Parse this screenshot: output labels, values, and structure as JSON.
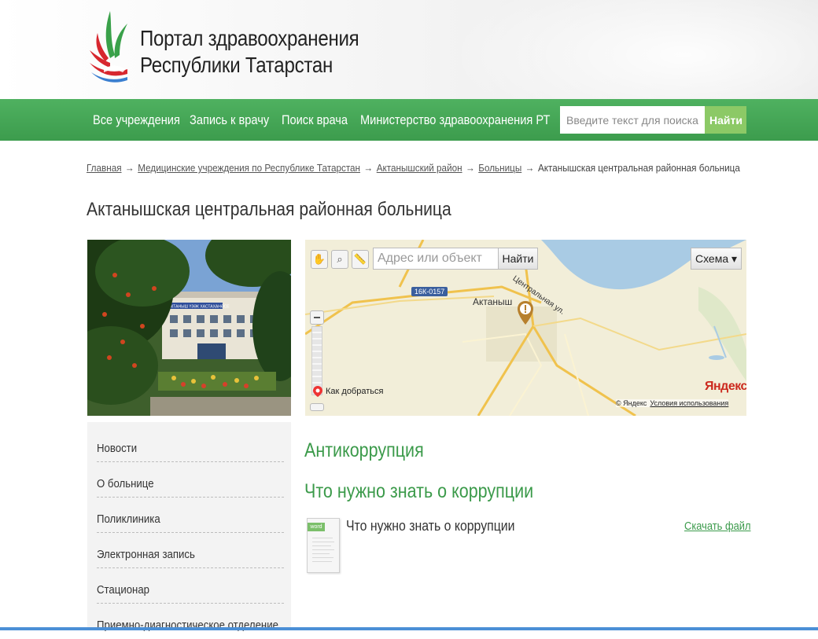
{
  "header": {
    "title_line1": "Портал здравоохранения",
    "title_line2": "Республики Татарстан"
  },
  "nav": {
    "items": [
      "Все учреждения",
      "Запись к врачу",
      "Поиск врача",
      "Министерство здравоохранения РТ"
    ],
    "search_placeholder": "Введите текст для поиска",
    "search_button": "Найти"
  },
  "breadcrumb": {
    "links": [
      "Главная",
      "Медицинские учреждения по Республике Татарстан",
      "Актанышский район",
      "Больницы"
    ],
    "current": "Актанышская центральная районная больница",
    "separator": "→"
  },
  "page_title": "Актанышская центральная районная больница",
  "photo": {
    "sign_text": "АКТАНЫШ ҮЗӘК ХАСТАХАНӘСЕ"
  },
  "map": {
    "search_placeholder": "Адрес или объект",
    "find_button": "Найти",
    "layer_button": "Схема ▾",
    "road_badge": "16К-0157",
    "town_label": "Актаныш",
    "street_label": "Центральная ул.",
    "how_to_get": "Как добраться",
    "copyright": "© Яндекс",
    "terms_link": "Условия использования",
    "brand": "Яндекс"
  },
  "sidebar": {
    "items": [
      "Новости",
      "О больнице",
      "Поликлиника",
      "Электронная запись",
      "Стационар",
      "Приемно-диагностическое отделение"
    ]
  },
  "content": {
    "section_title": "Антикоррупция",
    "subsection_title": "Что нужно знать о коррупции",
    "document": {
      "badge": "word",
      "title": "Что нужно знать о коррупции",
      "download_label": "Скачать файл"
    }
  },
  "colors": {
    "nav_green": "#3c9c4d",
    "heading_green": "#3b9a4a",
    "search_button": "#8cc966",
    "yandex_red": "#cc2a1f"
  }
}
